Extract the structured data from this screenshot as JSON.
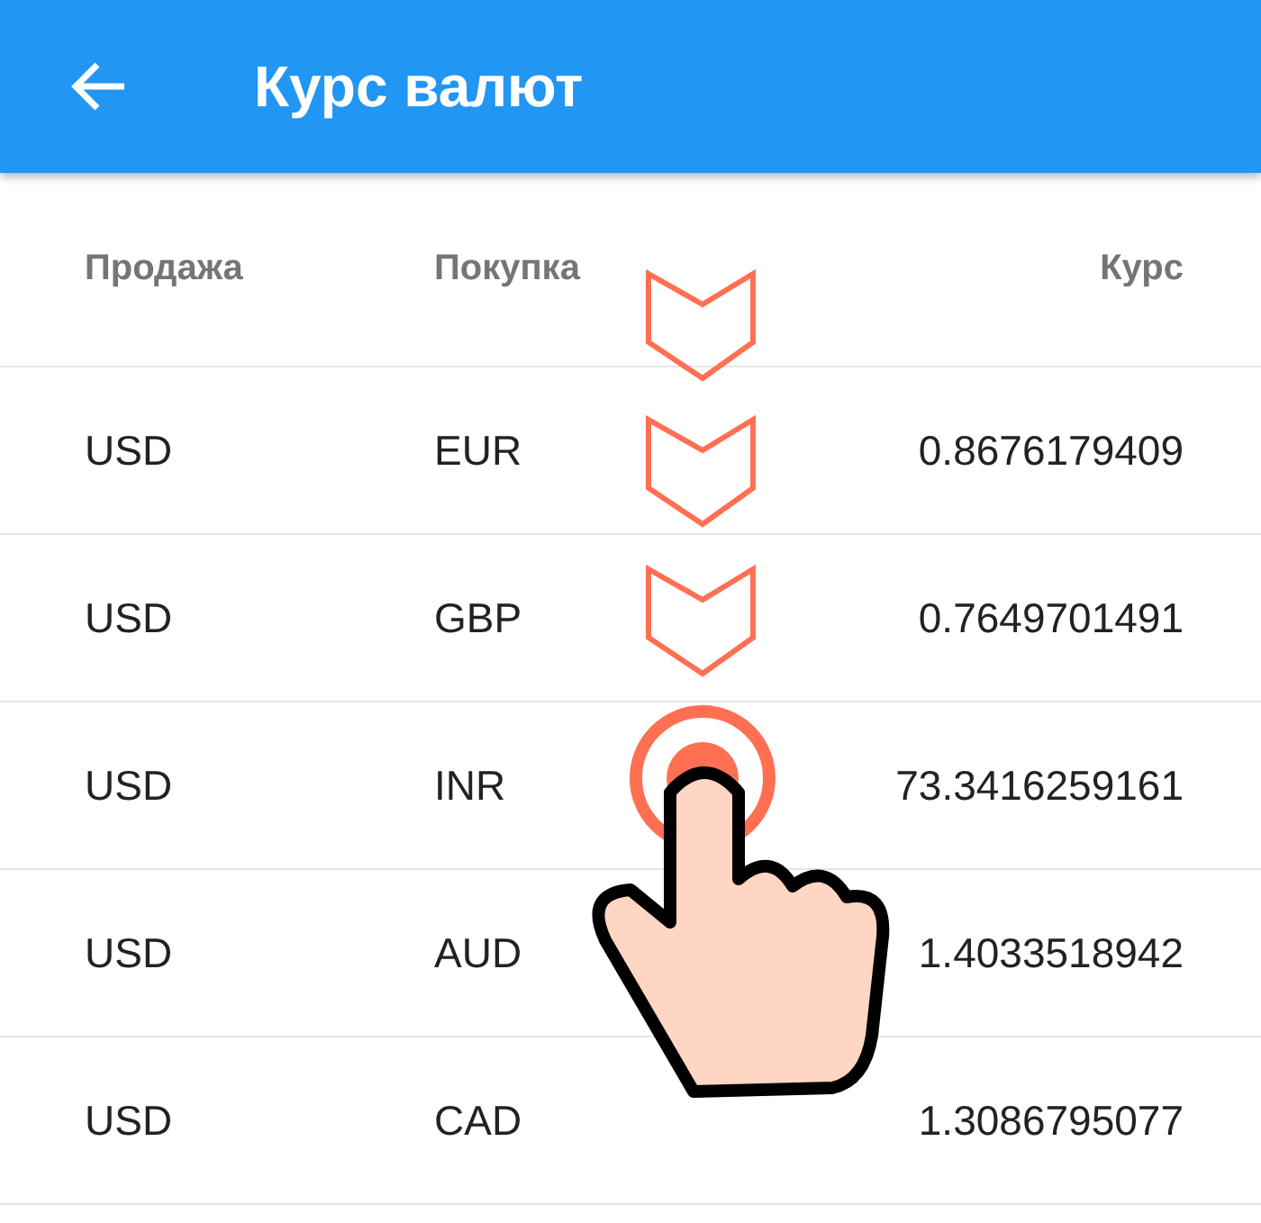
{
  "app_bar": {
    "title": "Курс валют"
  },
  "table": {
    "columns": [
      "Продажа",
      "Покупка",
      "Курс"
    ],
    "rows": [
      {
        "sell": "USD",
        "buy": "EUR",
        "rate": "0.8676179409"
      },
      {
        "sell": "USD",
        "buy": "GBP",
        "rate": "0.7649701491"
      },
      {
        "sell": "USD",
        "buy": "INR",
        "rate": "73.3416259161"
      },
      {
        "sell": "USD",
        "buy": "AUD",
        "rate": "1.4033518942"
      },
      {
        "sell": "USD",
        "buy": "CAD",
        "rate": "1.3086795077"
      }
    ]
  }
}
